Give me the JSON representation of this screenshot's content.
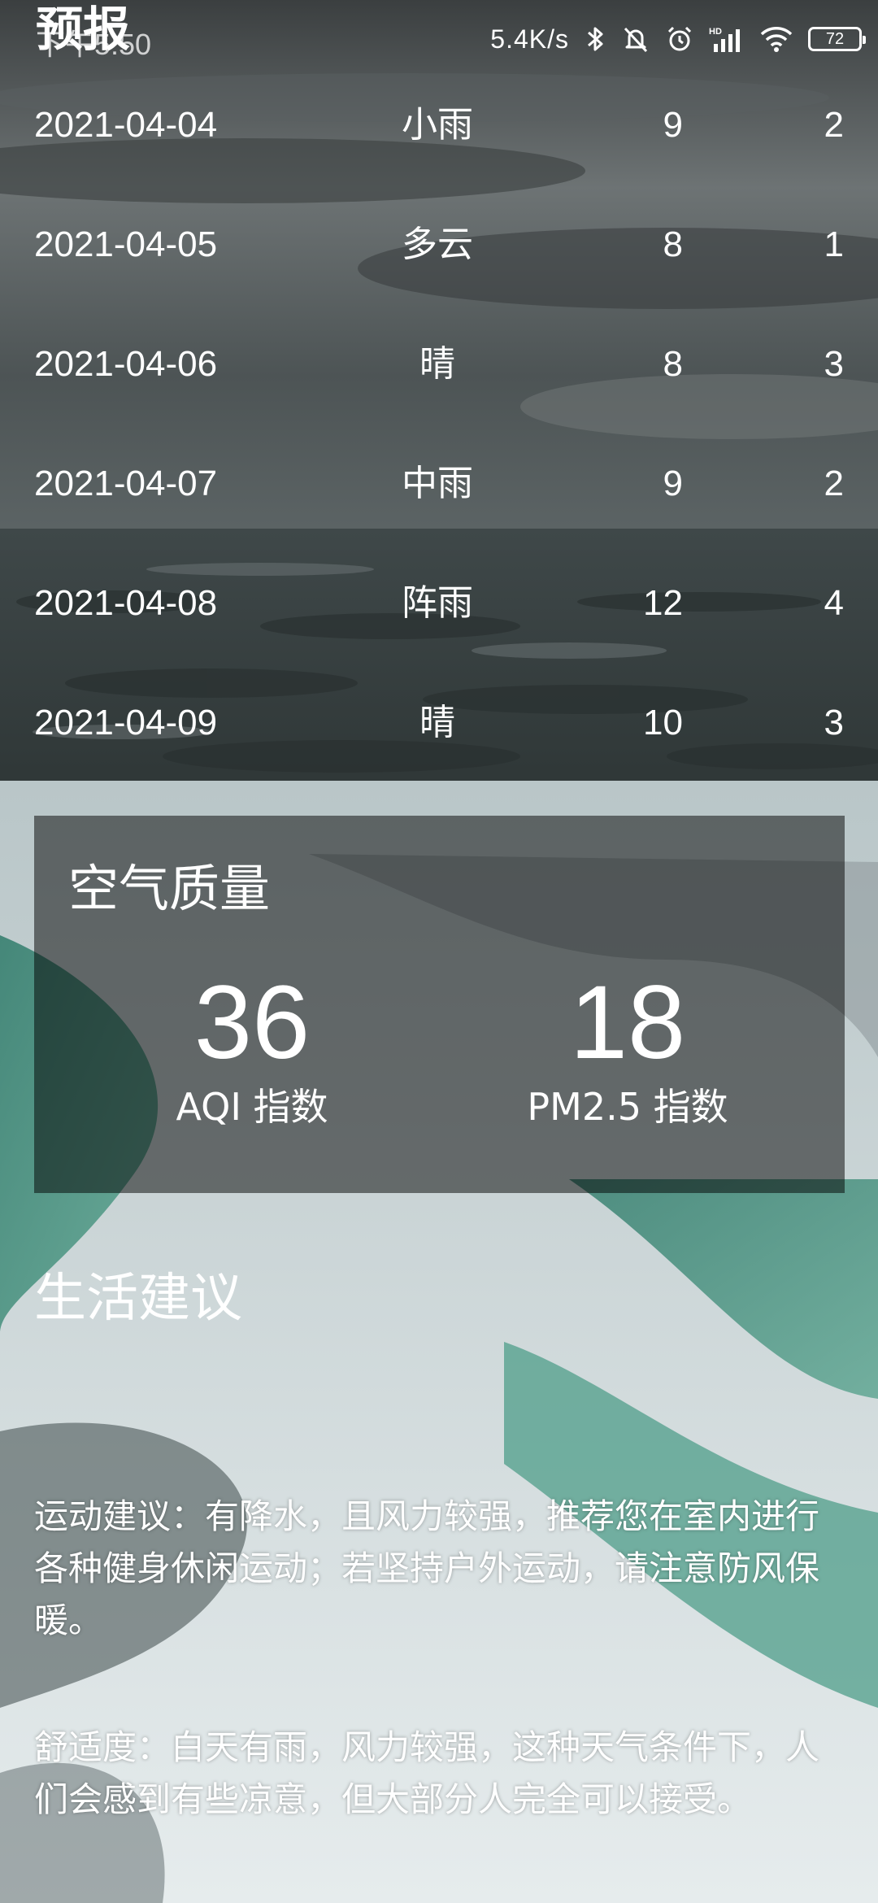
{
  "status_bar": {
    "time": "下午5:50",
    "net_speed": "5.4K/s",
    "battery": "72",
    "icons": [
      "bluetooth-icon",
      "mute-bell-icon",
      "alarm-clock-icon",
      "hd-signal-icon",
      "wifi-icon",
      "battery-icon"
    ]
  },
  "page": {
    "title": "预报"
  },
  "forecast": [
    {
      "date": "2021-04-04",
      "condition": "小雨",
      "max": "9",
      "min": "2"
    },
    {
      "date": "2021-04-05",
      "condition": "多云",
      "max": "8",
      "min": "1"
    },
    {
      "date": "2021-04-06",
      "condition": "晴",
      "max": "8",
      "min": "3"
    },
    {
      "date": "2021-04-07",
      "condition": "中雨",
      "max": "9",
      "min": "2"
    },
    {
      "date": "2021-04-08",
      "condition": "阵雨",
      "max": "12",
      "min": "4"
    },
    {
      "date": "2021-04-09",
      "condition": "晴",
      "max": "10",
      "min": "3"
    }
  ],
  "air_quality": {
    "title": "空气质量",
    "aqi_value": "36",
    "aqi_label": "AQI 指数",
    "pm25_value": "18",
    "pm25_label": "PM2.5 指数"
  },
  "life": {
    "title": "生活建议",
    "sport": "运动建议：有降水，且风力较强，推荐您在室内进行各种健身休闲运动；若坚持户外运动，请注意防风保暖。",
    "comfort": "舒适度：白天有雨，风力较强，这种天气条件下，人们会感到有些凉意，但大部分人完全可以接受。"
  }
}
